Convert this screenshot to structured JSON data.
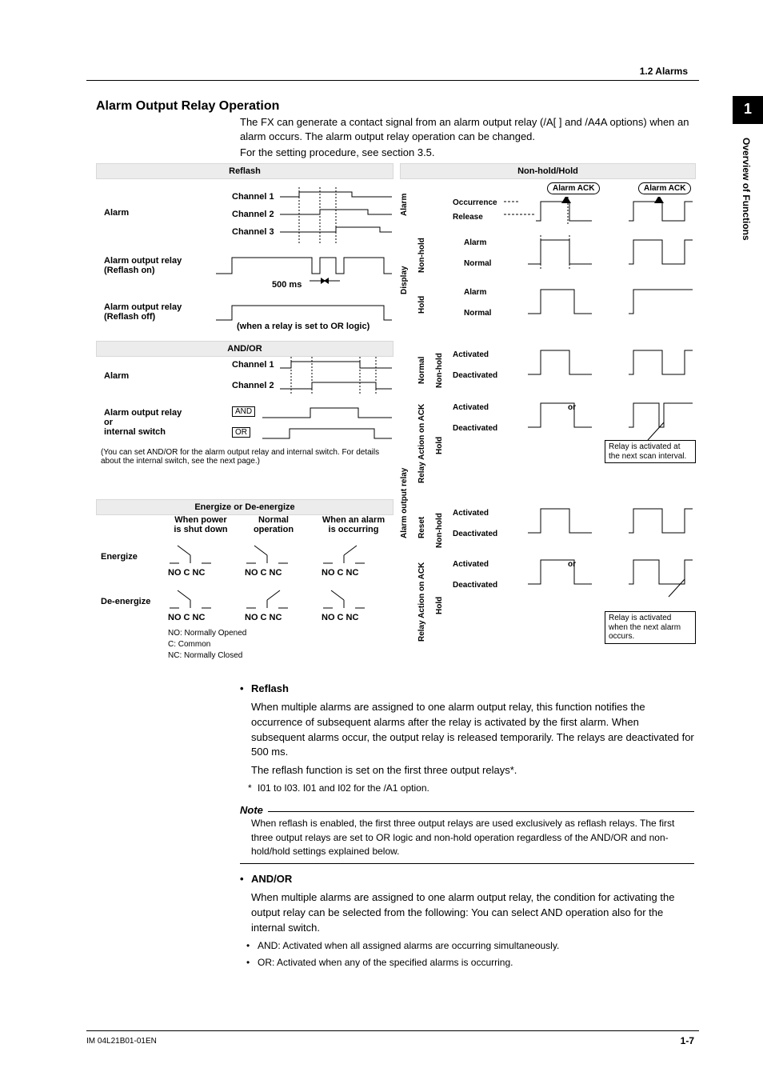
{
  "header": {
    "section_ref": "1.2  Alarms"
  },
  "sidebar": {
    "chapter_num": "1",
    "chapter_title": "Overview of Functions"
  },
  "title": "Alarm Output Relay Operation",
  "intro": {
    "p1": "The FX can generate a contact signal from an alarm output relay (/A[ ] and /A4A options) when an alarm occurs. The alarm output relay operation can be changed.",
    "p2": "For the setting procedure, see section 3.5."
  },
  "figure": {
    "left": {
      "bar1": "Reflash",
      "alarm": "Alarm",
      "ch1": "Channel 1",
      "ch2": "Channel 2",
      "ch3": "Channel 3",
      "relay_on": "Alarm output relay\n(Reflash on)",
      "relay_off": "Alarm output relay\n(Reflash off)",
      "ms500": "500 ms",
      "orlogic": "(when a relay is set to OR logic)",
      "bar2": "AND/OR",
      "ch1b": "Channel 1",
      "ch2b": "Channel 2",
      "alarm2": "Alarm",
      "a_or_int": "Alarm output relay\nor\ninternal switch",
      "and": "AND",
      "or": "OR",
      "footnote": "(You can set AND/OR for the alarm output relay and internal switch. For details about the internal switch, see the next page.)",
      "bar3": "Energize or De-energize",
      "col_power": "When power\nis shut down",
      "col_normal": "Normal\noperation",
      "col_alarm": "When an alarm\nis occurring",
      "energize": "Energize",
      "deenergize": "De-energize",
      "no_c_nc": "NO C   NC",
      "legend": {
        "no": "NO:  Normally Opened",
        "c": "C:     Common",
        "nc": "NC:  Normally Closed"
      }
    },
    "right": {
      "bar1": "Non-hold/Hold",
      "alarm_label": "Alarm",
      "display_label": "Display",
      "ack": "Alarm ACK",
      "occurrence": "Occurrence",
      "release": "Release",
      "nonhold": "Non-hold",
      "hold": "Hold",
      "alarm_row": "Alarm",
      "normal_row": "Normal",
      "relay_col": "Alarm output relay",
      "normal_v": "Normal",
      "reset_v": "Reset",
      "relay_ack": "Relay Action on ACK",
      "activated": "Activated",
      "deactivated": "Deactivated",
      "or_sep": "or",
      "note1": "Relay is activated at the next scan interval.",
      "note2": "Relay is activated when the next alarm occurs."
    }
  },
  "sections": {
    "reflash": {
      "bullet": "Reflash",
      "p1": "When multiple alarms are assigned to one alarm output relay, this function notifies the occurrence of subsequent alarms after the relay is activated by the first alarm. When subsequent alarms occur, the output relay is released temporarily. The relays are deactivated for 500 ms.",
      "p2": "The reflash function is set on the first three output relays*.",
      "star": "I01 to I03. I01 and I02 for the /A1 option."
    },
    "note": {
      "heading": "Note",
      "body": "When reflash is enabled, the first three output relays are used exclusively as reflash relays. The first three output relays are set to OR logic and non-hold operation regardless of the AND/OR and non-hold/hold settings explained below."
    },
    "andor": {
      "bullet": "AND/OR",
      "p1": "When multiple alarms are assigned to one alarm output relay, the condition for activating the output relay can be selected from the following: You can select AND operation also for the internal switch.",
      "and": "AND:  Activated when all assigned alarms are occurring simultaneously.",
      "or": "OR:    Activated when any of the specified alarms is occurring."
    }
  },
  "footer": {
    "doc_no": "IM 04L21B01-01EN",
    "page": "1-7"
  }
}
